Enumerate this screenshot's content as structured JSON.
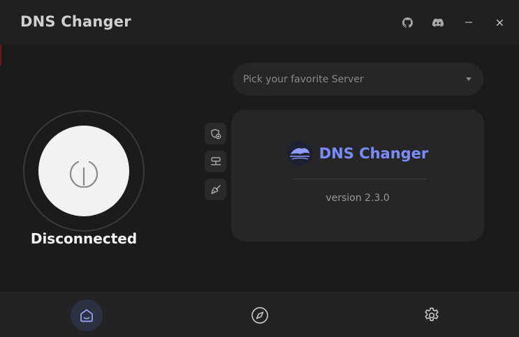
{
  "app": {
    "title": "DNS Changer"
  },
  "titlebar": {
    "icons": [
      "github-icon",
      "discord-icon",
      "minimize-icon",
      "close-icon"
    ]
  },
  "connection": {
    "status": "Disconnected",
    "icon": "power-icon"
  },
  "server_select": {
    "placeholder": "Pick your favorite Server"
  },
  "side_tools": [
    {
      "icon": "shield-plus-icon"
    },
    {
      "icon": "network-icon"
    },
    {
      "icon": "broom-icon"
    }
  ],
  "about": {
    "brand_name": "DNS Changer",
    "version": "version 2.3.0"
  },
  "nav": {
    "items": [
      {
        "icon": "home-icon",
        "active": true
      },
      {
        "icon": "compass-icon",
        "active": false
      },
      {
        "icon": "settings-icon",
        "active": false
      }
    ]
  },
  "colors": {
    "accent": "#7b8cff",
    "background": "#1b1b1b",
    "card": "#262626"
  }
}
